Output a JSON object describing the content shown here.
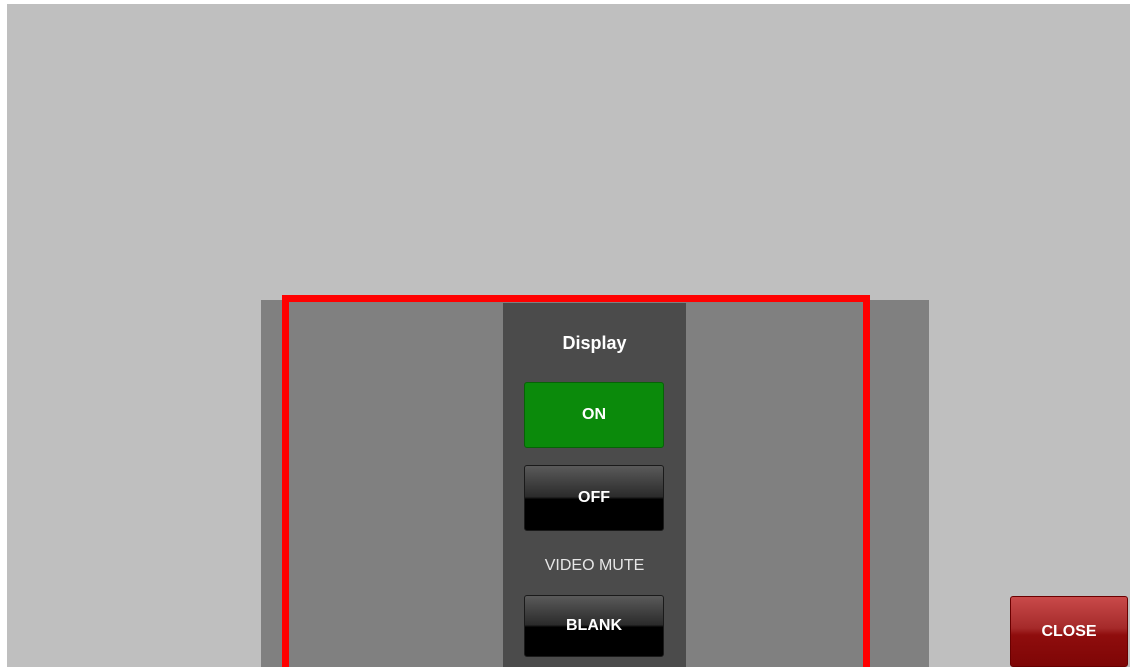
{
  "panel": {
    "title": "Display",
    "on_label": "ON",
    "off_label": "OFF",
    "video_mute_label": "VIDEO MUTE",
    "blank_label": "BLANK"
  },
  "footer": {
    "close_label": "CLOSE"
  },
  "colors": {
    "background": "#bfbfbf",
    "panel_outer": "#808080",
    "panel_column": "#4b4b4b",
    "on_active": "#0b8a0b",
    "highlight": "#ff0000",
    "close": "#a52a2a"
  },
  "state": {
    "display_power": "ON"
  }
}
